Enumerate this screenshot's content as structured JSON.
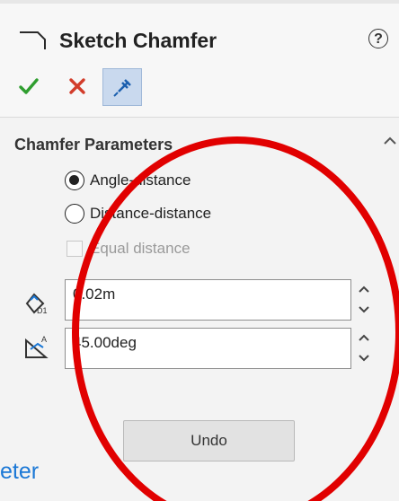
{
  "header": {
    "title": "Sketch Chamfer",
    "help_glyph": "?"
  },
  "section": {
    "title": "Chamfer Parameters",
    "options": [
      {
        "label": "Angle-distance",
        "selected": true
      },
      {
        "label": "Distance-distance",
        "selected": false
      }
    ],
    "equal_distance": {
      "label": "Equal distance",
      "checked": false,
      "enabled": false
    },
    "fields": [
      {
        "icon": "distance-icon",
        "value": "0.02m"
      },
      {
        "icon": "angle-icon",
        "value": "45.00deg"
      }
    ],
    "undo_label": "Undo"
  },
  "overlay": {
    "text": "eter"
  },
  "colors": {
    "accent": "#1b78d6",
    "ok": "#2f9e2f",
    "cancel": "#d23c2a",
    "annotation": "#e10000"
  }
}
